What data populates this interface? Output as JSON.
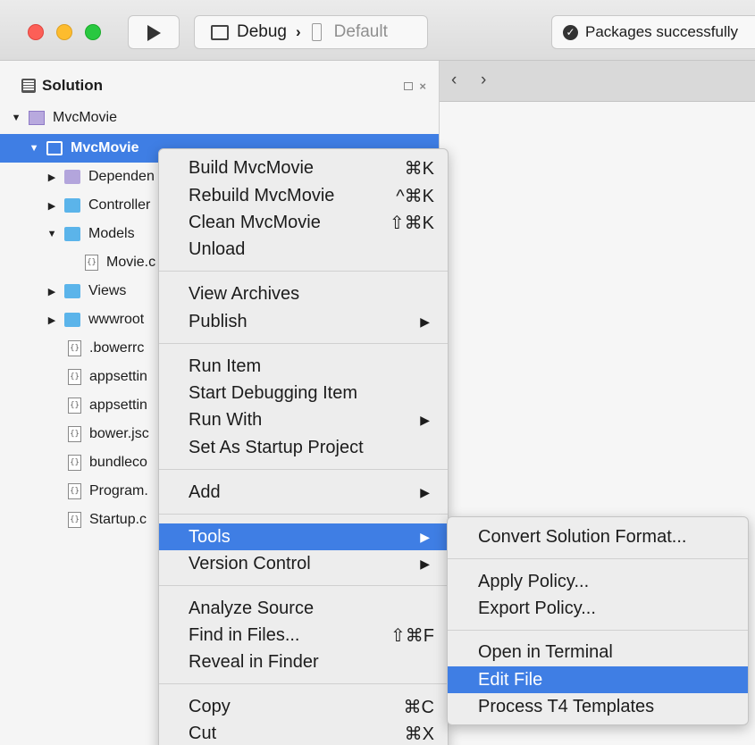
{
  "toolbar": {
    "config": "Debug",
    "device": "Default",
    "status": "Packages successfully"
  },
  "solution_pad": {
    "title": "Solution",
    "controls": {
      "close": "×"
    }
  },
  "tree": [
    {
      "label": "MvcMovie",
      "kind": "solution",
      "expanded": true
    },
    {
      "label": "MvcMovie",
      "kind": "project",
      "expanded": true,
      "selected": true
    },
    {
      "label": "Dependen",
      "kind": "folder-purple",
      "expanded": false
    },
    {
      "label": "Controller",
      "kind": "folder",
      "expanded": false
    },
    {
      "label": "Models",
      "kind": "folder",
      "expanded": true
    },
    {
      "label": "Movie.c",
      "kind": "file"
    },
    {
      "label": "Views",
      "kind": "folder",
      "expanded": false
    },
    {
      "label": "wwwroot",
      "kind": "folder",
      "expanded": false
    },
    {
      "label": ".bowerrc",
      "kind": "file"
    },
    {
      "label": "appsettin",
      "kind": "file"
    },
    {
      "label": "appsettin",
      "kind": "file"
    },
    {
      "label": "bower.jsc",
      "kind": "file"
    },
    {
      "label": "bundleco",
      "kind": "file"
    },
    {
      "label": "Program.",
      "kind": "file"
    },
    {
      "label": "Startup.c",
      "kind": "file"
    }
  ],
  "editor": {
    "back": "‹",
    "forward": "›"
  },
  "context_menu": [
    {
      "label": "Build MvcMovie",
      "shortcut": "⌘K"
    },
    {
      "label": "Rebuild MvcMovie",
      "shortcut": "^⌘K"
    },
    {
      "label": "Clean MvcMovie",
      "shortcut": "⇧⌘K"
    },
    {
      "label": "Unload",
      "shortcut": ""
    },
    {
      "label": "View Archives",
      "shortcut": ""
    },
    {
      "label": "Publish",
      "shortcut": "",
      "submenu": true
    },
    {
      "label": "Run Item",
      "shortcut": ""
    },
    {
      "label": "Start Debugging Item",
      "shortcut": ""
    },
    {
      "label": "Run With",
      "shortcut": "",
      "submenu": true
    },
    {
      "label": "Set As Startup Project",
      "shortcut": ""
    },
    {
      "label": "Add",
      "shortcut": "",
      "submenu": true
    },
    {
      "label": "Tools",
      "shortcut": "",
      "submenu": true,
      "highlighted": true
    },
    {
      "label": "Version Control",
      "shortcut": "",
      "submenu": true
    },
    {
      "label": "Analyze Source",
      "shortcut": ""
    },
    {
      "label": "Find in Files...",
      "shortcut": "⇧⌘F"
    },
    {
      "label": "Reveal in Finder",
      "shortcut": ""
    },
    {
      "label": "Copy",
      "shortcut": "⌘C"
    },
    {
      "label": "Cut",
      "shortcut": "⌘X"
    }
  ],
  "tools_submenu": [
    {
      "label": "Convert Solution Format..."
    },
    {
      "label": "Apply Policy..."
    },
    {
      "label": "Export Policy..."
    },
    {
      "label": "Open in Terminal"
    },
    {
      "label": "Edit File",
      "highlighted": true
    },
    {
      "label": "Process T4 Templates"
    }
  ],
  "colors": {
    "selection": "#3f7ee4",
    "folder": "#5bb4ea"
  }
}
